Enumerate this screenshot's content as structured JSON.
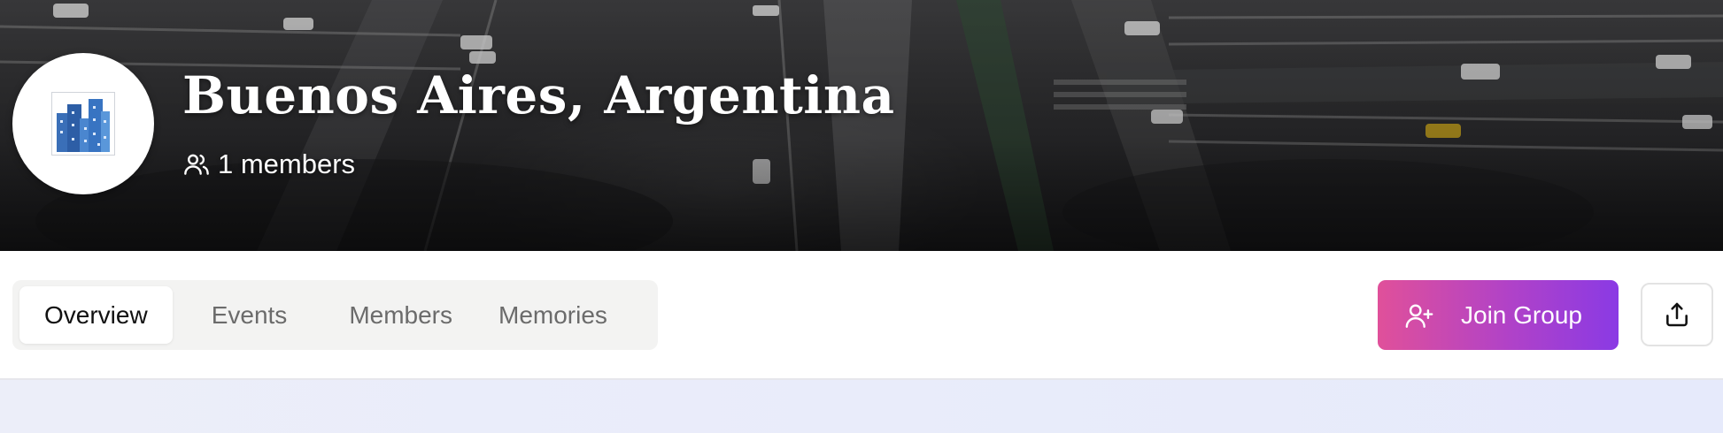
{
  "group": {
    "title": "Buenos Aires, Argentina",
    "member_count_text": "1 members",
    "avatar_icon": "city-skyline-icon"
  },
  "tabs": [
    {
      "label": "Overview",
      "active": true
    },
    {
      "label": "Events",
      "active": false
    },
    {
      "label": "Members",
      "active": false
    },
    {
      "label": "Memories",
      "active": false
    }
  ],
  "actions": {
    "join_label": "Join Group",
    "join_icon": "user-plus-icon",
    "share_icon": "share-icon"
  },
  "colors": {
    "join_gradient_start": "#e0509a",
    "join_gradient_end": "#8a3ae4",
    "tabs_background": "#f3f3f2",
    "content_background": "#e8ebfa"
  }
}
